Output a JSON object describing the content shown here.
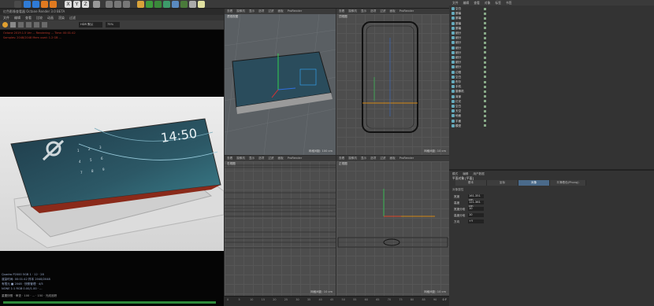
{
  "render_window": {
    "title": "红色影像查看器 Octane Render 3.0 BETA",
    "menu": [
      "文件",
      "编辑",
      "查看",
      "比较",
      "动画",
      "渲染",
      "过滤"
    ],
    "display_mode": "HDR 默认",
    "zoom": "75%",
    "log_lines": [
      "Octane 2019.1.5 Ver ... Rendering ... Time: 00:01:42",
      "Samples: 2048/2048  Mem used: 1.2 GB  ..."
    ],
    "screen_time": "14:50",
    "bottom_stats": [
      "Quadro P2000 5GB 1  ·  12  ·  28",
      "渲染时间: 00:01:42  样本 2048/2048",
      "有限元 ■ 2048  ·  快照管理 · 4/5",
      "NONE 1:1 RGB 0.00/1.00  ·  ...",
      "重置快照 · 审查 · 100 · ...  · 150 · 光线追踪"
    ]
  },
  "viewports": [
    {
      "menu": [
        "查看",
        "摄像机",
        "显示",
        "选项",
        "过滤",
        "面板",
        "ProRender"
      ],
      "label": "透视视图",
      "footer": "网格间距: 100 cm"
    },
    {
      "menu": [
        "查看",
        "摄像机",
        "显示",
        "选项",
        "过滤",
        "面板",
        "ProRender"
      ],
      "label": "顶视图",
      "footer": "网格间距: 10 cm"
    },
    {
      "menu": [
        "查看",
        "摄像机",
        "显示",
        "选项",
        "过滤",
        "面板",
        "ProRender"
      ],
      "label": "右视图",
      "footer": "网格间距: 10 cm"
    },
    {
      "menu": [
        "查看",
        "摄像机",
        "显示",
        "选项",
        "过滤",
        "面板",
        "ProRender"
      ],
      "label": "正视图",
      "footer": "网格间距: 10 cm"
    }
  ],
  "object_manager": {
    "menu": [
      "文件",
      "编辑",
      "查看",
      "对象",
      "标签",
      "书签"
    ],
    "rows": [
      "空白",
      "屏幕",
      "屏幕",
      "屏幕",
      "屏幕",
      "细分",
      "细分",
      "细分",
      "细分",
      "细分",
      "细分",
      "细分",
      "细分",
      "边框",
      "空白",
      "布尔",
      "手机",
      "摄像机",
      "背景",
      "灯光",
      "空白",
      "天空",
      "地面",
      "平面",
      "模型"
    ]
  },
  "attributes": {
    "menu": [
      "模式",
      "编辑",
      "用户数据"
    ],
    "object_title": "平面对象 [平面]",
    "tabs": [
      "基本",
      "坐标",
      "对象",
      "平滑着色(Phong)"
    ],
    "section": "对象属性",
    "fields": [
      {
        "label": "宽度",
        "value": "161.351 cm"
      },
      {
        "label": "高度",
        "value": "121.361 cm"
      },
      {
        "label": "宽度分段",
        "value": "10"
      },
      {
        "label": "高度分段",
        "value": "10"
      },
      {
        "label": "方向",
        "value": "+Y"
      }
    ]
  },
  "timeline": {
    "ticks": [
      "0",
      "5",
      "10",
      "15",
      "20",
      "25",
      "30",
      "35",
      "40",
      "45",
      "50",
      "55",
      "60",
      "65",
      "70",
      "75",
      "80",
      "85",
      "90"
    ],
    "frame": "0 F"
  },
  "colors": {
    "accent": "#4a6a8a",
    "axis_x": "#e03030",
    "axis_y": "#30d050",
    "axis_z": "#3070e0",
    "selection": "#ff9a00"
  }
}
